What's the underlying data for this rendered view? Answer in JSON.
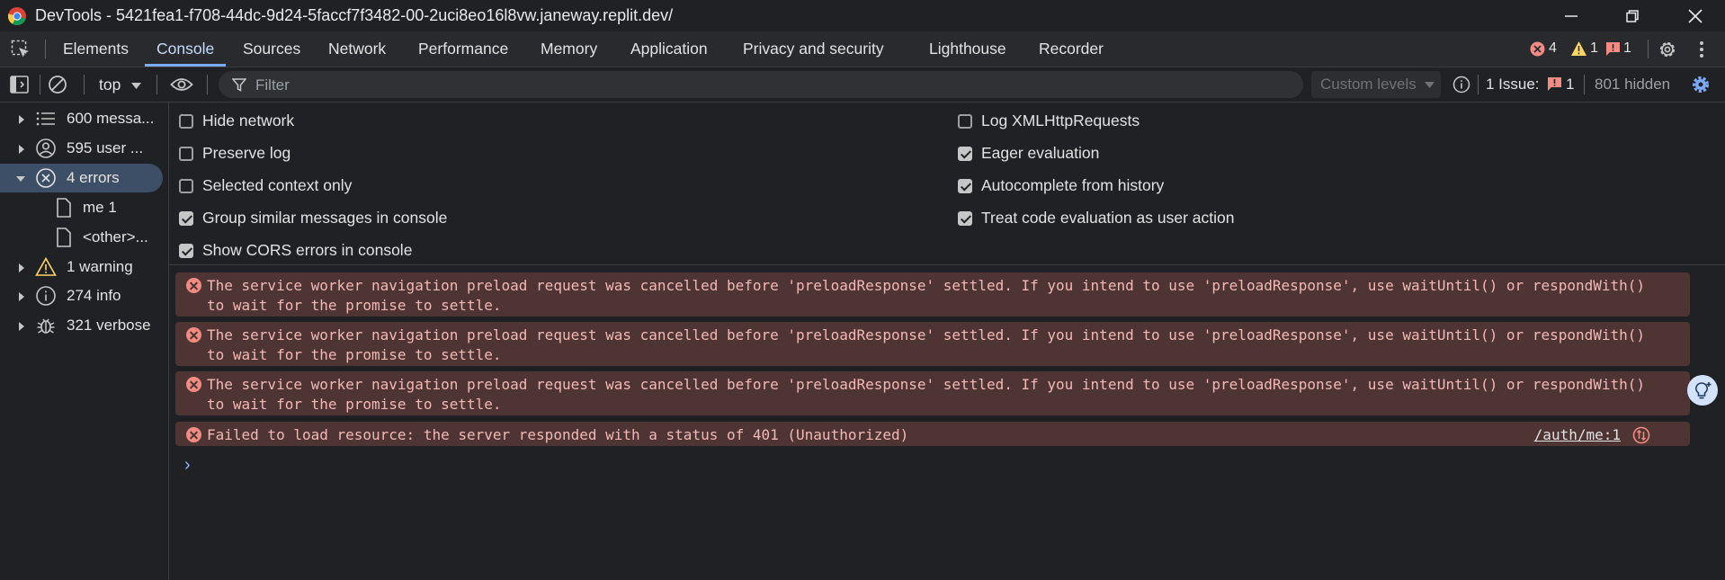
{
  "window": {
    "title": "DevTools - 5421fea1-f708-44dc-9d24-5faccf7f3482-00-2uci8eo16l8vw.janeway.replit.dev/"
  },
  "tabs": [
    "Elements",
    "Console",
    "Sources",
    "Network",
    "Performance",
    "Memory",
    "Application",
    "Privacy and security",
    "Lighthouse",
    "Recorder"
  ],
  "active_tab": "Console",
  "status_counts": {
    "errors": "4",
    "warnings": "1",
    "issues": "1"
  },
  "toolbar": {
    "context": "top",
    "filter_placeholder": "Filter",
    "levels": "Custom levels",
    "issues_label": "1 Issue:",
    "issues_count": "1",
    "hidden": "801 hidden"
  },
  "sidebar": {
    "items": [
      {
        "label": "600 messa...",
        "icon": "list-icon"
      },
      {
        "label": "595 user ...",
        "icon": "user-icon"
      },
      {
        "label": "4 errors",
        "icon": "error-icon"
      },
      {
        "label": "me  1",
        "icon": "file-icon"
      },
      {
        "label": "<other>...",
        "icon": "file-icon"
      },
      {
        "label": "1 warning",
        "icon": "warning-icon"
      },
      {
        "label": "274 info",
        "icon": "info-icon"
      },
      {
        "label": "321 verbose",
        "icon": "bug-icon"
      }
    ]
  },
  "settings": {
    "left": [
      {
        "label": "Hide network",
        "checked": false
      },
      {
        "label": "Preserve log",
        "checked": false
      },
      {
        "label": "Selected context only",
        "checked": false
      },
      {
        "label": "Group similar messages in console",
        "checked": true
      },
      {
        "label": "Show CORS errors in console",
        "checked": true
      }
    ],
    "right": [
      {
        "label": "Log XMLHttpRequests",
        "checked": false
      },
      {
        "label": "Eager evaluation",
        "checked": true
      },
      {
        "label": "Autocomplete from history",
        "checked": true
      },
      {
        "label": "Treat code evaluation as user action",
        "checked": true
      }
    ]
  },
  "messages": [
    {
      "text": "The service worker navigation preload request was cancelled before 'preloadResponse' settled. If you intend to use 'preloadResponse', use waitUntil() or respondWith()\nto wait for the promise to settle."
    },
    {
      "text": "The service worker navigation preload request was cancelled before 'preloadResponse' settled. If you intend to use 'preloadResponse', use waitUntil() or respondWith()\nto wait for the promise to settle."
    },
    {
      "text": "The service worker navigation preload request was cancelled before 'preloadResponse' settled. If you intend to use 'preloadResponse', use waitUntil() or respondWith()\nto wait for the promise to settle."
    },
    {
      "text": "Failed to load resource: the server responded with a status of 401 (Unauthorized)",
      "source": "/auth/me:1"
    }
  ],
  "colors": {
    "error": "#f28b82",
    "warning": "#fdd663",
    "accent": "#7cacf8"
  }
}
